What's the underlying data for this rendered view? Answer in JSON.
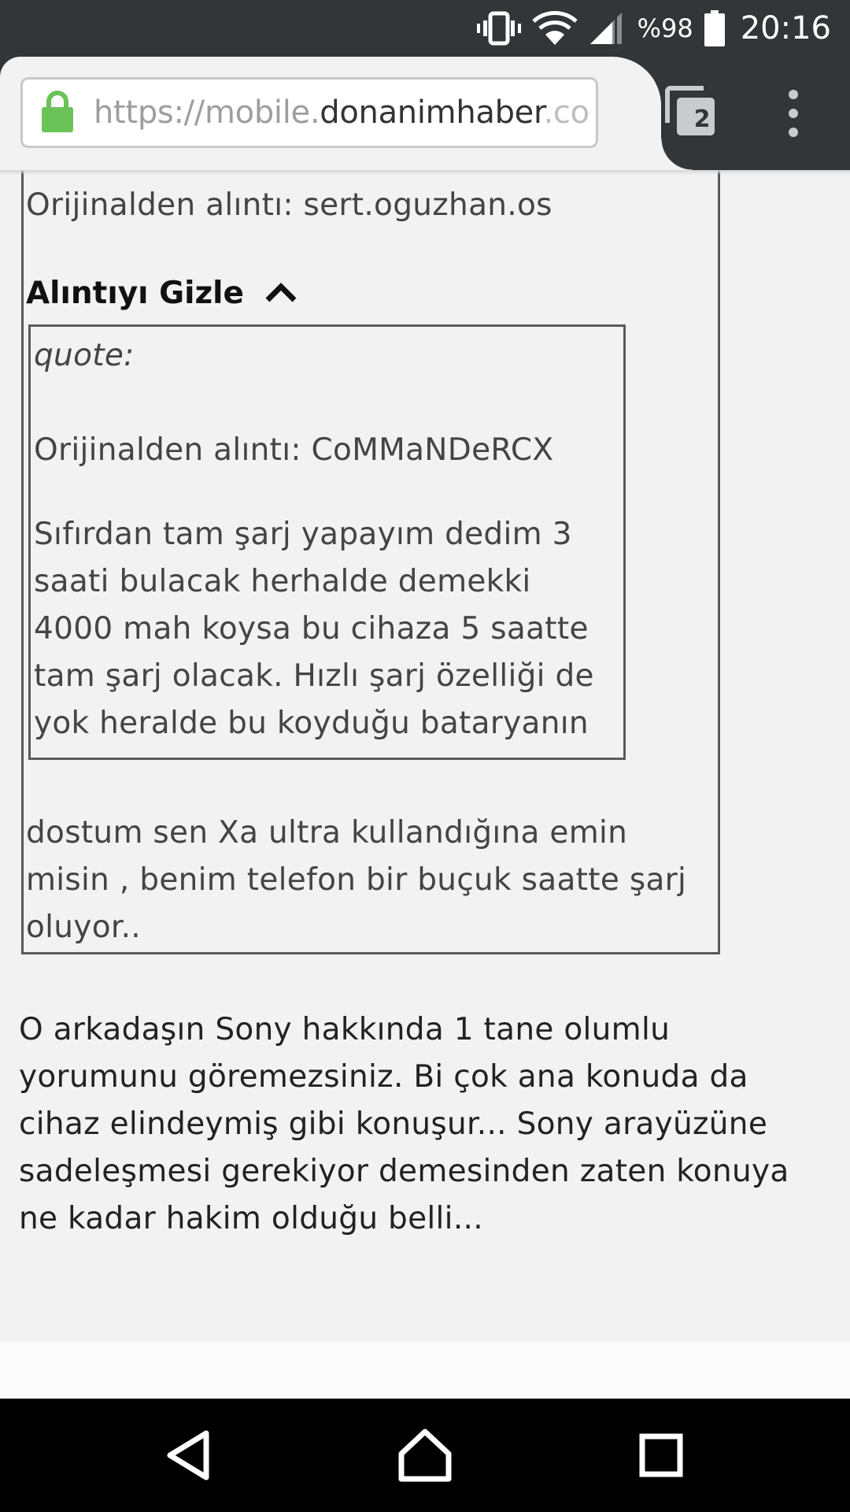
{
  "status_bar": {
    "battery": "%98",
    "time": "20:16",
    "icons": [
      "vibrate-icon",
      "wifi-icon",
      "cell-signal-icon",
      "battery-icon"
    ]
  },
  "browser": {
    "url_scheme": "https://mobile.",
    "url_host": "donanimhaber",
    "url_rest": ".co",
    "tab_count": "2",
    "icons": [
      "lock-icon",
      "tabs-icon",
      "more-vert-icon"
    ],
    "colors": {
      "toolbar": "#323639",
      "lock": "#6ac259"
    }
  },
  "post": {
    "outer_quote": {
      "attribution": "Orijinalden alıntı: sert.oguzhan.os",
      "toggle_label": "Alıntıyı Gizle",
      "inner_quote": {
        "label": "quote:",
        "attribution": "Orijinalden alıntı: CoMMaNDeRCX",
        "lines": [
          "Sıfırdan tam şarj yapayım dedim 3",
          "saati bulacak herhalde demekki",
          "4000 mah koysa bu cihaza 5 saatte",
          "tam şarj olacak. Hızlı şarj özelliği de",
          "yok heralde bu koyduğu bataryanın"
        ]
      },
      "reply_lines": [
        "dostum sen Xa ultra kullandığına emin",
        "misin , benim telefon bir buçuk saatte şarj",
        "oluyor.."
      ]
    },
    "body_lines": [
      "O arkadaşın Sony hakkında 1 tane olumlu",
      "yorumunu göremezsiniz. Bi çok ana konuda da",
      "cihaz elindeymiş gibi konuşur... Sony arayüzüne",
      "sadeleşmesi gerekiyor demesinden zaten konuya",
      "ne kadar hakim olduğu belli..."
    ]
  },
  "nav_bar": {
    "icons": [
      "back-icon",
      "home-icon",
      "recents-icon"
    ]
  }
}
